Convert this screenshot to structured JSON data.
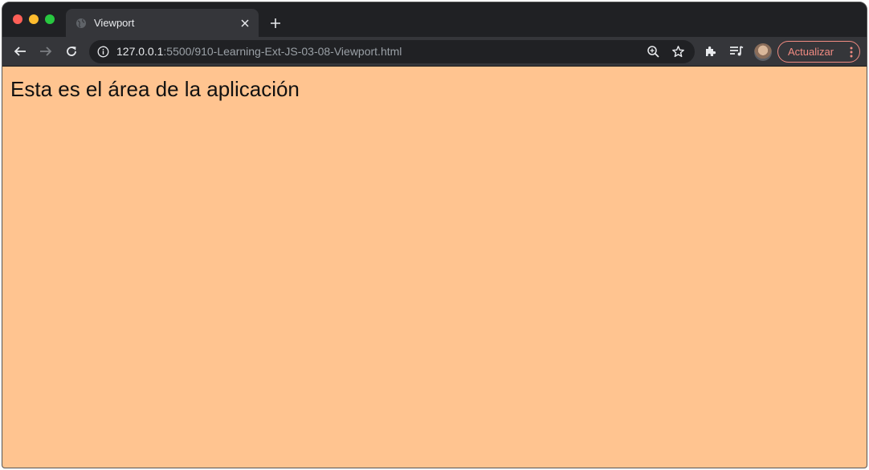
{
  "tab": {
    "title": "Viewport"
  },
  "toolbar": {
    "url_host": "127.0.0.1",
    "url_rest": ":5500/910-Learning-Ext-JS-03-08-Viewport.html",
    "update_label": "Actualizar"
  },
  "page": {
    "text": "Esta es el área de la aplicación",
    "background": "#ffc490"
  },
  "icons": {
    "favicon": "globe-icon",
    "close": "close-icon",
    "new_tab": "plus-icon",
    "back": "back-arrow-icon",
    "forward": "forward-arrow-icon",
    "reload": "reload-icon",
    "site_info": "info-icon",
    "zoom": "zoom-icon",
    "bookmark": "star-icon",
    "extensions": "puzzle-icon",
    "media": "media-queue-icon",
    "menu": "kebab-menu-icon"
  }
}
